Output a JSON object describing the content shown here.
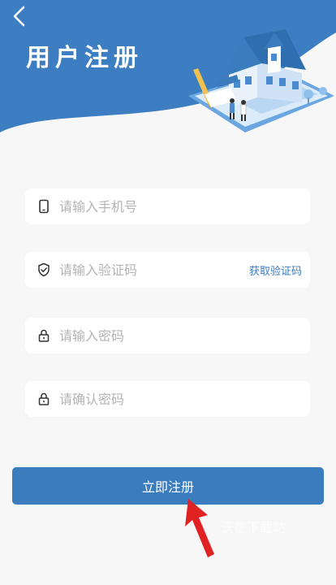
{
  "header": {
    "title": "用户注册",
    "back_icon": "chevron-left-icon",
    "illustration": "house-illustration",
    "colors": {
      "wave": "#3c7ec1"
    }
  },
  "form": {
    "phone": {
      "placeholder": "请输入手机号",
      "value": "",
      "icon": "phone-icon"
    },
    "code": {
      "placeholder": "请输入验证码",
      "value": "",
      "icon": "shield-check-icon",
      "action_label": "获取验证码"
    },
    "password": {
      "placeholder": "请输入密码",
      "value": "",
      "icon": "lock-icon"
    },
    "confirm": {
      "placeholder": "请确认密码",
      "value": "",
      "icon": "lock-icon"
    }
  },
  "submit": {
    "label": "立即注册",
    "color": "#3b7cbf"
  },
  "overlay": {
    "watermark": "沃德下载站",
    "arrow_color": "#e02222"
  }
}
